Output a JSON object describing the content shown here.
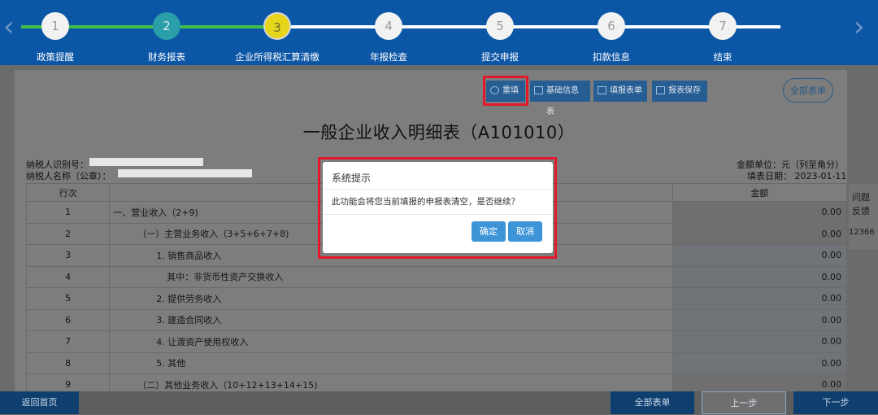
{
  "progress": {
    "steps": [
      {
        "number": "1",
        "label": "政策提醒",
        "state": "pending"
      },
      {
        "number": "2",
        "label": "财务报表",
        "state": "done"
      },
      {
        "number": "3",
        "label": "企业所得税汇算清缴",
        "state": "current"
      },
      {
        "number": "4",
        "label": "年报检查",
        "state": "pending"
      },
      {
        "number": "5",
        "label": "提交申报",
        "state": "pending"
      },
      {
        "number": "6",
        "label": "扣款信息",
        "state": "pending"
      },
      {
        "number": "7",
        "label": "结束",
        "state": "pending"
      }
    ],
    "prev_arrow": "‹",
    "next_arrow": "›",
    "colors": {
      "bar": "#0c56a6",
      "done_line": "#3fbf4a",
      "pending_line": "#ffffff",
      "done": "#2a9ea9",
      "current": "#e5d51b"
    }
  },
  "toolbar": {
    "refill_label": "重填",
    "basic_info_label": "基础信息表",
    "fill_list_label": "填报表单",
    "save_label": "报表保存",
    "all_forms_label": "全部表单"
  },
  "form": {
    "title": "一般企业收入明细表（A101010）",
    "taxpayer_id_label": "纳税人识别号：",
    "taxpayer_name_label": "纳税人名称（公章）：",
    "unit_label": "金额单位：元（列至角分）",
    "fill_date_label": "填表日期： 2023-01-11",
    "columns": [
      "行次",
      "",
      "金额"
    ],
    "rows": [
      {
        "line": "1",
        "item": "一、营业收入（2+9)",
        "amount": "0.00"
      },
      {
        "line": "2",
        "item": "（一）主营业务收入（3+5+6+7+8)",
        "amount": "0.00"
      },
      {
        "line": "3",
        "item": "1. 销售商品收入",
        "amount": "0.00"
      },
      {
        "line": "4",
        "item": "其中：非货币性资产交换收入",
        "amount": "0.00"
      },
      {
        "line": "5",
        "item": "2. 提供劳务收入",
        "amount": "0.00"
      },
      {
        "line": "6",
        "item": "3. 建造合同收入",
        "amount": "0.00"
      },
      {
        "line": "7",
        "item": "4. 让渡资产使用权收入",
        "amount": "0.00"
      },
      {
        "line": "8",
        "item": "5. 其他",
        "amount": "0.00"
      },
      {
        "line": "9",
        "item": "（二）其他业务收入（10+12+13+14+15)",
        "amount": "0.00"
      }
    ]
  },
  "side_widget": {
    "line1": "问题",
    "line2": "反馈",
    "line3": "12366"
  },
  "bottom": {
    "home_label": "返回首页",
    "all_forms_label": "全部表单",
    "prev_label": "上一步",
    "next_label": "下一步"
  },
  "dialog": {
    "title": "系统提示",
    "message": "此功能会将您当前填报的申报表清空，是否继续？",
    "confirm_label": "确定",
    "cancel_label": "取消"
  }
}
